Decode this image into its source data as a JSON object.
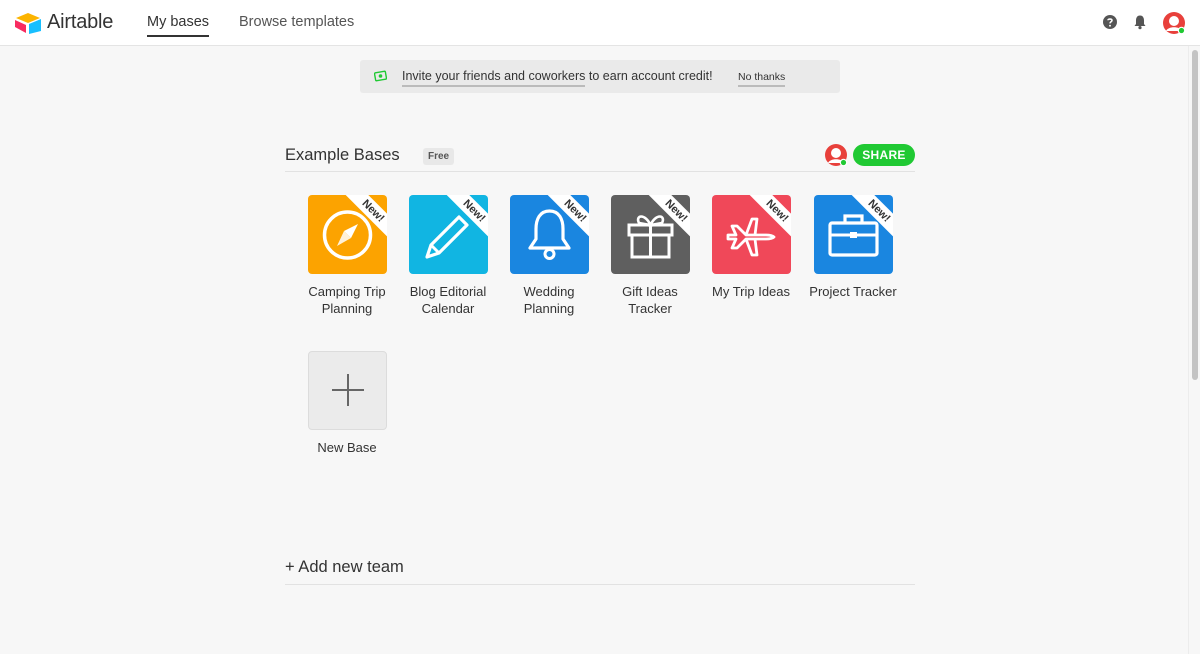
{
  "app": {
    "name": "Airtable"
  },
  "nav": {
    "tabs": [
      {
        "label": "My bases",
        "active": true
      },
      {
        "label": "Browse templates",
        "active": false
      }
    ]
  },
  "banner": {
    "link_text": "Invite your friends and coworkers",
    "rest_text": " to earn account credit!",
    "dismiss": "No thanks"
  },
  "workspace": {
    "title": "Example Bases",
    "plan_badge": "Free",
    "share_label": "SHARE",
    "bases": [
      {
        "name": "Camping Trip Planning",
        "color": "#fca300",
        "icon": "compass-icon",
        "ribbon": "New!"
      },
      {
        "name": "Blog Editorial Calendar",
        "color": "#11b5e2",
        "icon": "pencil-icon",
        "ribbon": "New!"
      },
      {
        "name": "Wedding Planning",
        "color": "#1a86e0",
        "icon": "bell-icon",
        "ribbon": "New!"
      },
      {
        "name": "Gift Ideas Tracker",
        "color": "#5f5f5f",
        "icon": "gift-icon",
        "ribbon": "New!"
      },
      {
        "name": "My Trip Ideas",
        "color": "#f04859",
        "icon": "airplane-icon",
        "ribbon": "New!"
      },
      {
        "name": "Project Tracker",
        "color": "#1a86e0",
        "icon": "briefcase-icon",
        "ribbon": "New!"
      }
    ],
    "new_base_label": "New Base"
  },
  "add_team_label": "+ Add new team",
  "colors": {
    "accent_green": "#20c933",
    "avatar_red": "#e8403b"
  }
}
